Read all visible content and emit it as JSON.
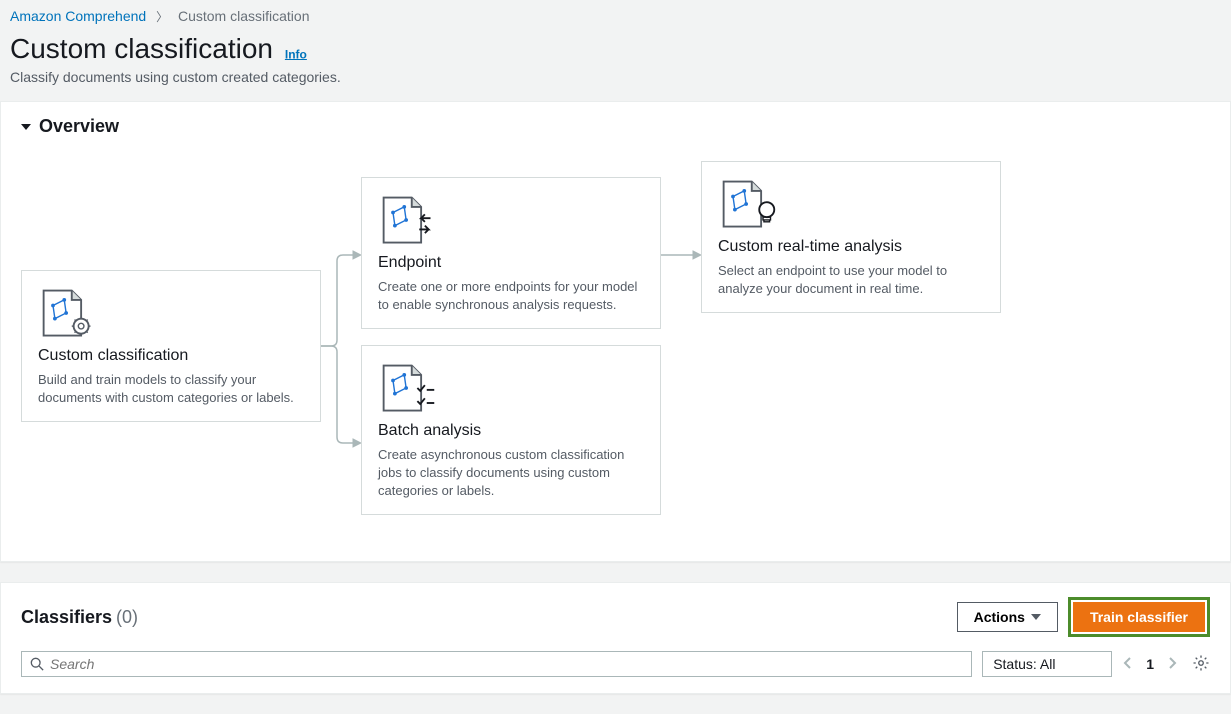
{
  "breadcrumb": {
    "root": "Amazon Comprehend",
    "current": "Custom classification"
  },
  "header": {
    "title": "Custom classification",
    "info": "Info",
    "subtitle": "Classify documents using custom created categories."
  },
  "overview": {
    "heading": "Overview",
    "cards": {
      "classification": {
        "title": "Custom classification",
        "desc": "Build and train models to classify your documents with custom categories or labels."
      },
      "endpoint": {
        "title": "Endpoint",
        "desc": "Create one or more endpoints for your model to enable synchronous analysis requests."
      },
      "realtime": {
        "title": "Custom real-time analysis",
        "desc": "Select an endpoint to use your model to analyze your document in real time."
      },
      "batch": {
        "title": "Batch analysis",
        "desc": "Create asynchronous custom classification jobs to classify documents using custom categories or labels."
      }
    }
  },
  "classifiers": {
    "heading": "Classifiers",
    "count": "(0)",
    "actions_label": "Actions",
    "train_label": "Train classifier",
    "search_placeholder": "Search",
    "status_label": "Status: All",
    "page": "1"
  }
}
